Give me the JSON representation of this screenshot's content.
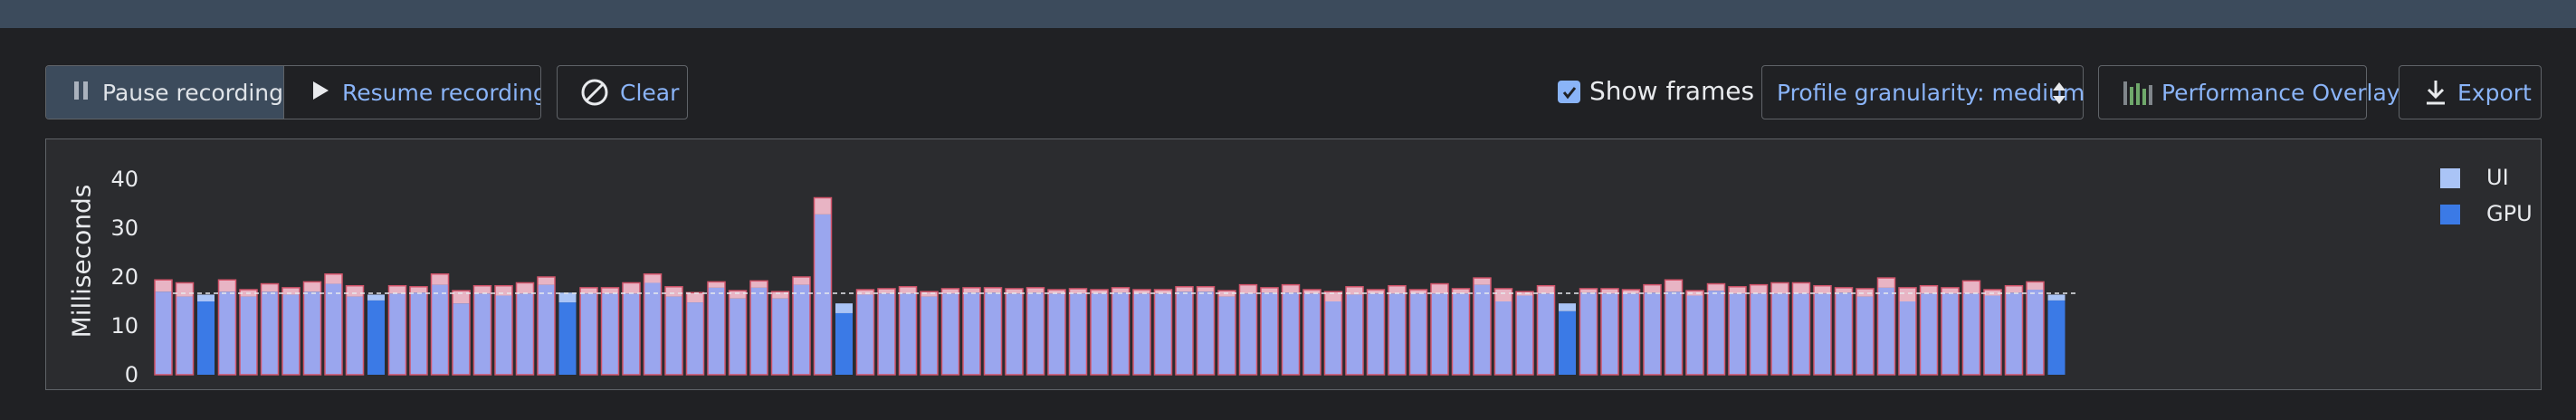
{
  "toolbar": {
    "pause_label": "Pause recording",
    "resume_label": "Resume recording",
    "clear_label": "Clear",
    "show_frames_label": "Show frames",
    "show_frames_checked": true,
    "granularity_label": "Profile granularity: medium",
    "overlay_label": "Performance Overlay",
    "export_label": "Export"
  },
  "icons": {
    "pause": "pause-icon",
    "resume": "play-icon",
    "clear": "block-icon",
    "select": "updown-arrows-icon",
    "overlay": "bar-chart-icon",
    "export": "download-icon"
  },
  "colors": {
    "ui": "#9aa6ee",
    "gpu": "#3b7ae6",
    "jank": "#e8b4c4",
    "border": "#d2546a",
    "accent": "#8ab4f8"
  },
  "chart_data": {
    "type": "bar",
    "ylabel": "Milliseconds",
    "yticks": [
      "0",
      "10",
      "20",
      "30",
      "40"
    ],
    "ylim": [
      0,
      40
    ],
    "threshold_ms": 16.67,
    "legend": [
      "UI",
      "GPU"
    ],
    "legend_position": "top-right",
    "frames": [
      {
        "ui": 17,
        "raster": 2.4,
        "gpu": false
      },
      {
        "ui": 16,
        "raster": 2.8,
        "gpu": false
      },
      {
        "ui": 15,
        "raster": 1.4,
        "gpu": true
      },
      {
        "ui": 17,
        "raster": 2.4,
        "gpu": false
      },
      {
        "ui": 16,
        "raster": 1.4,
        "gpu": false
      },
      {
        "ui": 17,
        "raster": 1.6,
        "gpu": false
      },
      {
        "ui": 16.4,
        "raster": 1.4,
        "gpu": false
      },
      {
        "ui": 17,
        "raster": 2,
        "gpu": false
      },
      {
        "ui": 18.6,
        "raster": 2,
        "gpu": false
      },
      {
        "ui": 16,
        "raster": 2.2,
        "gpu": false
      },
      {
        "ui": 15.2,
        "raster": 1.2,
        "gpu": true
      },
      {
        "ui": 16.6,
        "raster": 1.6,
        "gpu": false
      },
      {
        "ui": 16.8,
        "raster": 1.2,
        "gpu": false
      },
      {
        "ui": 18.4,
        "raster": 2.2,
        "gpu": false
      },
      {
        "ui": 14.6,
        "raster": 2.6,
        "gpu": false
      },
      {
        "ui": 16.6,
        "raster": 1.6,
        "gpu": false
      },
      {
        "ui": 16.2,
        "raster": 2,
        "gpu": false
      },
      {
        "ui": 16.6,
        "raster": 2.2,
        "gpu": false
      },
      {
        "ui": 18.4,
        "raster": 1.6,
        "gpu": false
      },
      {
        "ui": 14.8,
        "raster": 2,
        "gpu": true
      },
      {
        "ui": 16.6,
        "raster": 1.2,
        "gpu": false
      },
      {
        "ui": 16.6,
        "raster": 1.2,
        "gpu": false
      },
      {
        "ui": 16.6,
        "raster": 2.2,
        "gpu": false
      },
      {
        "ui": 18.8,
        "raster": 1.8,
        "gpu": false
      },
      {
        "ui": 16,
        "raster": 2,
        "gpu": false
      },
      {
        "ui": 14.8,
        "raster": 2,
        "gpu": false
      },
      {
        "ui": 17.8,
        "raster": 1.2,
        "gpu": false
      },
      {
        "ui": 15.6,
        "raster": 1.6,
        "gpu": false
      },
      {
        "ui": 17.8,
        "raster": 1.4,
        "gpu": false
      },
      {
        "ui": 15.6,
        "raster": 1.4,
        "gpu": false
      },
      {
        "ui": 18.4,
        "raster": 1.6,
        "gpu": false
      },
      {
        "ui": 32.8,
        "raster": 3.4,
        "gpu": false
      },
      {
        "ui": 12.6,
        "raster": 2,
        "gpu": true
      },
      {
        "ui": 16.4,
        "raster": 1,
        "gpu": false
      },
      {
        "ui": 16.6,
        "raster": 1,
        "gpu": false
      },
      {
        "ui": 16.6,
        "raster": 1.4,
        "gpu": false
      },
      {
        "ui": 16,
        "raster": 1,
        "gpu": false
      },
      {
        "ui": 16.6,
        "raster": 1,
        "gpu": false
      },
      {
        "ui": 16.8,
        "raster": 1,
        "gpu": false
      },
      {
        "ui": 16.8,
        "raster": 1,
        "gpu": false
      },
      {
        "ui": 16.6,
        "raster": 1,
        "gpu": false
      },
      {
        "ui": 16.8,
        "raster": 1,
        "gpu": false
      },
      {
        "ui": 16.6,
        "raster": 0.8,
        "gpu": false
      },
      {
        "ui": 16.6,
        "raster": 1,
        "gpu": false
      },
      {
        "ui": 16.6,
        "raster": 0.8,
        "gpu": false
      },
      {
        "ui": 16.8,
        "raster": 1,
        "gpu": false
      },
      {
        "ui": 16.6,
        "raster": 0.8,
        "gpu": false
      },
      {
        "ui": 16.6,
        "raster": 0.8,
        "gpu": false
      },
      {
        "ui": 17,
        "raster": 1,
        "gpu": false
      },
      {
        "ui": 17,
        "raster": 1,
        "gpu": false
      },
      {
        "ui": 16,
        "raster": 1.2,
        "gpu": false
      },
      {
        "ui": 16.6,
        "raster": 1.8,
        "gpu": false
      },
      {
        "ui": 16.8,
        "raster": 1,
        "gpu": false
      },
      {
        "ui": 16.8,
        "raster": 1.6,
        "gpu": false
      },
      {
        "ui": 16.6,
        "raster": 0.8,
        "gpu": false
      },
      {
        "ui": 15,
        "raster": 2,
        "gpu": false
      },
      {
        "ui": 16.4,
        "raster": 1.6,
        "gpu": false
      },
      {
        "ui": 16.6,
        "raster": 0.8,
        "gpu": false
      },
      {
        "ui": 16.6,
        "raster": 1.6,
        "gpu": false
      },
      {
        "ui": 16.6,
        "raster": 0.8,
        "gpu": false
      },
      {
        "ui": 16.6,
        "raster": 2,
        "gpu": false
      },
      {
        "ui": 16.6,
        "raster": 1,
        "gpu": false
      },
      {
        "ui": 18.4,
        "raster": 1.4,
        "gpu": false
      },
      {
        "ui": 15,
        "raster": 2.6,
        "gpu": false
      },
      {
        "ui": 16.2,
        "raster": 0.8,
        "gpu": false
      },
      {
        "ui": 16.6,
        "raster": 1.6,
        "gpu": false
      },
      {
        "ui": 13,
        "raster": 1.6,
        "gpu": true
      },
      {
        "ui": 16.8,
        "raster": 0.8,
        "gpu": false
      },
      {
        "ui": 16.6,
        "raster": 1,
        "gpu": false
      },
      {
        "ui": 16.6,
        "raster": 0.8,
        "gpu": false
      },
      {
        "ui": 16.8,
        "raster": 1.6,
        "gpu": false
      },
      {
        "ui": 17,
        "raster": 2.4,
        "gpu": false
      },
      {
        "ui": 16.2,
        "raster": 1,
        "gpu": false
      },
      {
        "ui": 17.2,
        "raster": 1.4,
        "gpu": false
      },
      {
        "ui": 16.6,
        "raster": 1.4,
        "gpu": false
      },
      {
        "ui": 16.6,
        "raster": 1.8,
        "gpu": false
      },
      {
        "ui": 16.6,
        "raster": 2.2,
        "gpu": false
      },
      {
        "ui": 16.6,
        "raster": 2.2,
        "gpu": false
      },
      {
        "ui": 16.6,
        "raster": 1.6,
        "gpu": false
      },
      {
        "ui": 16.8,
        "raster": 1,
        "gpu": false
      },
      {
        "ui": 16,
        "raster": 1.6,
        "gpu": false
      },
      {
        "ui": 17.8,
        "raster": 2,
        "gpu": false
      },
      {
        "ui": 15,
        "raster": 2.8,
        "gpu": false
      },
      {
        "ui": 16.6,
        "raster": 1.6,
        "gpu": false
      },
      {
        "ui": 16.6,
        "raster": 1.2,
        "gpu": false
      },
      {
        "ui": 16.6,
        "raster": 2.6,
        "gpu": false
      },
      {
        "ui": 16.2,
        "raster": 1.2,
        "gpu": false
      },
      {
        "ui": 16.8,
        "raster": 1.4,
        "gpu": false
      },
      {
        "ui": 17.4,
        "raster": 1.6,
        "gpu": false
      },
      {
        "ui": 15.2,
        "raster": 1.2,
        "gpu": true
      }
    ]
  }
}
